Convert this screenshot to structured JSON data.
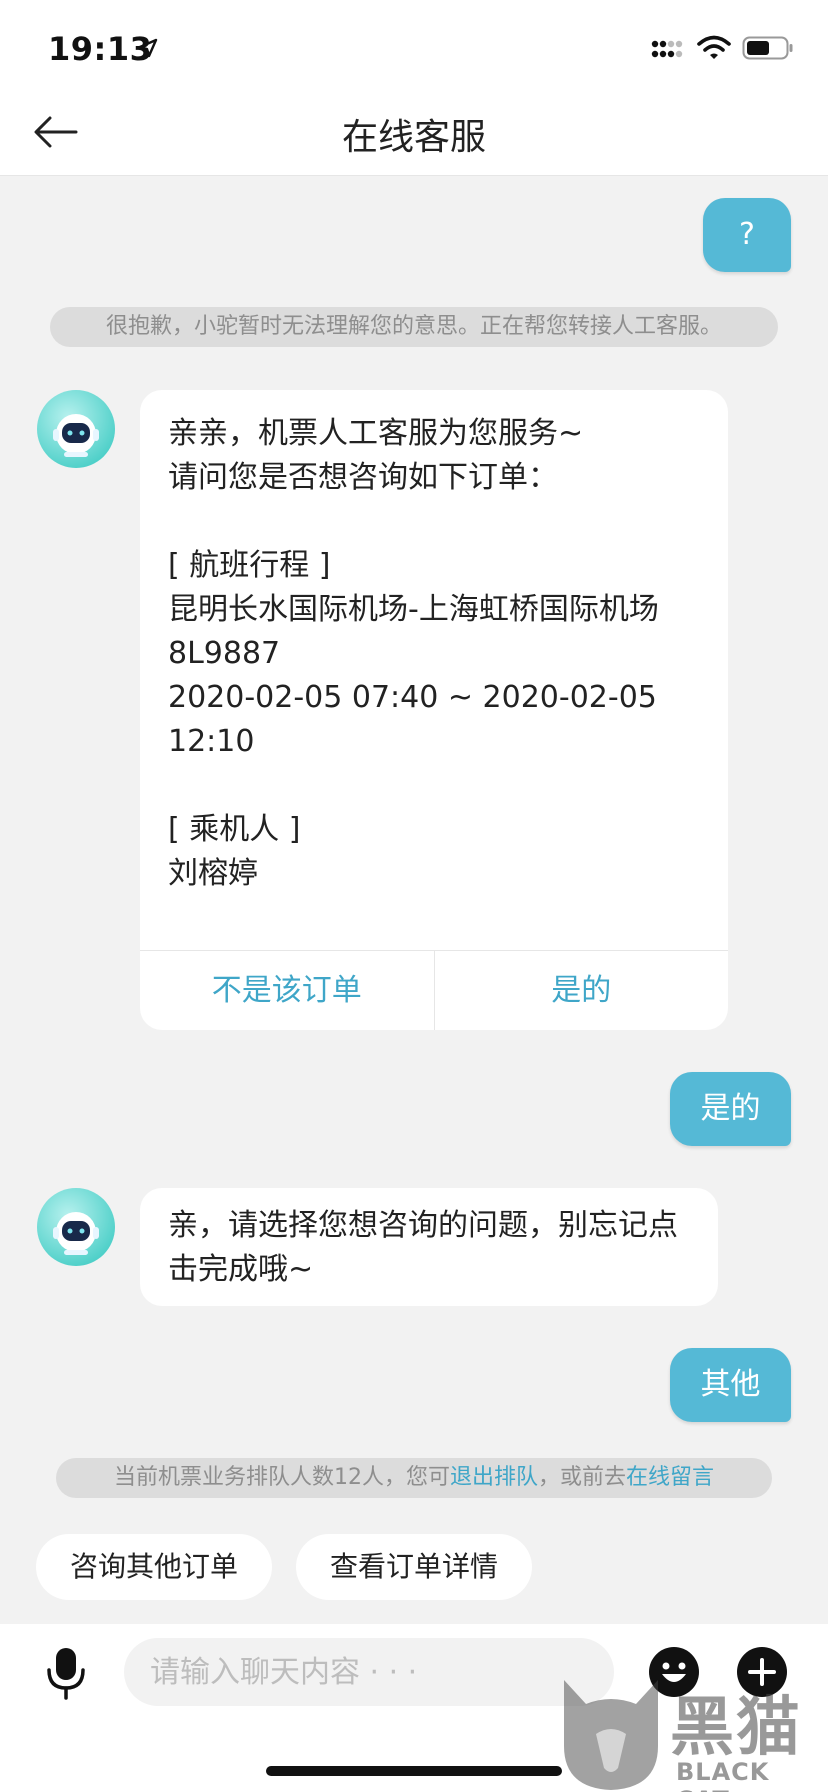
{
  "status_bar": {
    "time": "19:13"
  },
  "header": {
    "title": "在线客服"
  },
  "messages": {
    "user_1": "?",
    "system_1": "很抱歉，小驼暂时无法理解您的意思。正在帮您转接人工客服。",
    "bot_1": {
      "text": "亲亲，机票人工客服为您服务~\n请问您是否想咨询如下订单：\n\n[ 航班行程 ]\n昆明长水国际机场-上海虹桥国际机场\n8L9887\n2020-02-05 07:40 ~ 2020-02-05 12:10\n\n[ 乘机人 ]\n刘榕婷",
      "button_no": "不是该订单",
      "button_yes": "是的"
    },
    "user_2": "是的",
    "bot_2": "亲，请选择您想咨询的问题，别忘记点击完成哦~",
    "user_3": "其他",
    "queue": {
      "prefix": "当前机票业务排队人数12人，您可",
      "exit_link": "退出排队",
      "middle": "，或前去",
      "message_link": "在线留言"
    }
  },
  "quick_replies": [
    "咨询其他订单",
    "查看订单详情"
  ],
  "input": {
    "placeholder": "请输入聊天内容 · · ·"
  },
  "watermark": {
    "cn": "黑猫",
    "en": "BLACK CAT"
  },
  "colors": {
    "accent": "#55b9d6",
    "link": "#3fa6c8",
    "background": "#f2f2f2"
  }
}
